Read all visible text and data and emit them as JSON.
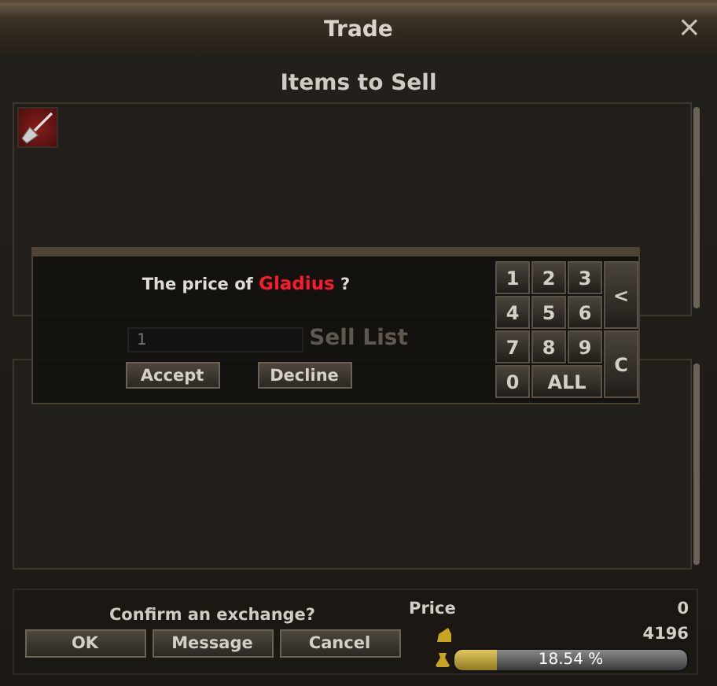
{
  "window": {
    "title": "Trade",
    "close": "×"
  },
  "items_to_sell": {
    "heading": "Items to Sell",
    "items": [
      {
        "kind": "weapon"
      }
    ]
  },
  "sell_list": {
    "heading": "Sell List"
  },
  "price_dialog": {
    "prompt_prefix": "The price of",
    "item_name": "Gladius",
    "prompt_suffix": "?",
    "input": {
      "value": "1"
    },
    "buttons": [
      "Accept",
      "Decline"
    ],
    "keypad": [
      {
        "label": "1",
        "kind": "digit"
      },
      {
        "label": "2",
        "kind": "digit"
      },
      {
        "label": "3",
        "kind": "digit"
      },
      {
        "label": "<",
        "kind": "back"
      },
      {
        "label": "4",
        "kind": "digit"
      },
      {
        "label": "5",
        "kind": "digit"
      },
      {
        "label": "6",
        "kind": "digit"
      },
      {
        "label": "7",
        "kind": "digit"
      },
      {
        "label": "8",
        "kind": "digit"
      },
      {
        "label": "9",
        "kind": "digit"
      },
      {
        "label": "C",
        "kind": "clear"
      },
      {
        "label": "0",
        "kind": "digit"
      },
      {
        "label": "ALL",
        "kind": "all"
      }
    ]
  },
  "footer": {
    "confirm": "Confirm an exchange?",
    "buttons": [
      "OK",
      "Message",
      "Cancel"
    ],
    "price_label": "Price",
    "price": "0",
    "money": "4196",
    "weight": {
      "level": 0.1854,
      "reading": "18.54 %"
    }
  }
}
